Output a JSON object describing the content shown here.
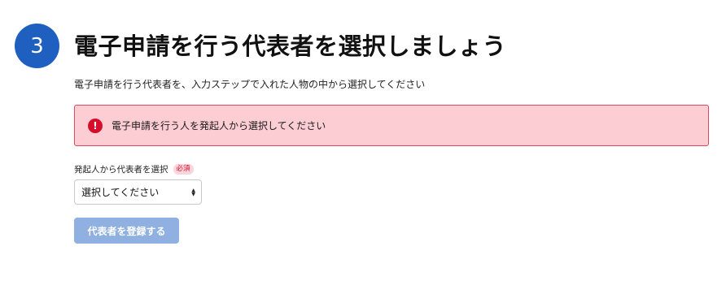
{
  "step": {
    "number": "3"
  },
  "title": "電子申請を行う代表者を選択しましょう",
  "description": "電子申請を行う代表者を、入力ステップで入れた人物の中から選択してください",
  "error": {
    "icon": "exclamation-icon",
    "icon_glyph": "!",
    "message": "電子申請を行う人を発起人から選択してください"
  },
  "field": {
    "label": "発起人から代表者を選択",
    "required_badge": "必須",
    "selected_value": "選択してください",
    "arrow_up": "▲",
    "arrow_down": "▼"
  },
  "submit_button": {
    "label": "代表者を登録する"
  },
  "colors": {
    "step_circle": "#1f5fc0",
    "error_background": "#fdcdd4",
    "error_border": "#d94a5f",
    "error_icon": "#d60e2b",
    "button_disabled": "#8fb0e0"
  }
}
